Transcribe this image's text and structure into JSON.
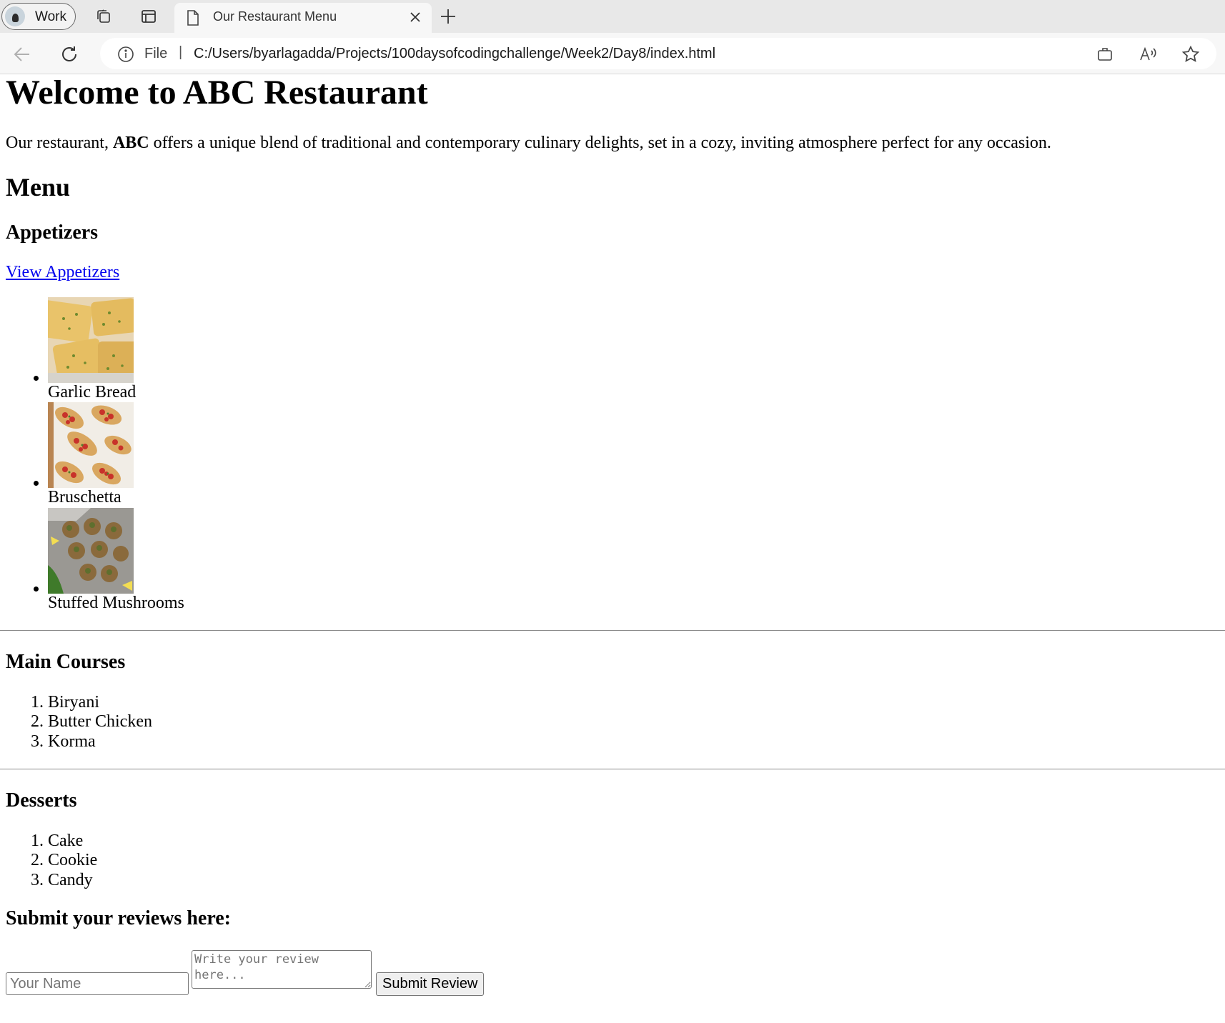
{
  "browser": {
    "profile_label": "Work",
    "tab_title": "Our Restaurant Menu",
    "scheme_label": "File",
    "url": "C:/Users/byarlagadda/Projects/100daysofcodingchallenge/Week2/Day8/index.html"
  },
  "page": {
    "heading": "Welcome to ABC Restaurant",
    "intro_prefix": "Our restaurant, ",
    "intro_bold": "ABC",
    "intro_suffix": " offers a unique blend of traditional and contemporary culinary delights, set in a cozy, inviting atmosphere perfect for any occasion.",
    "menu_heading": "Menu",
    "appetizers": {
      "heading": "Appetizers",
      "link_text": "View Appetizers",
      "items": [
        {
          "name": "Garlic Bread",
          "image": "garlic-bread-photo"
        },
        {
          "name": "Bruschetta",
          "image": "bruschetta-photo"
        },
        {
          "name": "Stuffed Mushrooms",
          "image": "stuffed-mushrooms-photo"
        }
      ]
    },
    "main_courses": {
      "heading": "Main Courses",
      "items": [
        "Biryani",
        "Butter Chicken",
        "Korma"
      ]
    },
    "desserts": {
      "heading": "Desserts",
      "items": [
        "Cake",
        "Cookie",
        "Candy"
      ]
    },
    "reviews": {
      "heading": "Submit your reviews here:",
      "name_placeholder": "Your Name",
      "review_placeholder": "Write your review here...",
      "submit_label": "Submit Review"
    }
  },
  "colors": {
    "link": "#0000ee",
    "tabstrip": "#e8e8e8",
    "toolbar": "#f7f7f7"
  }
}
